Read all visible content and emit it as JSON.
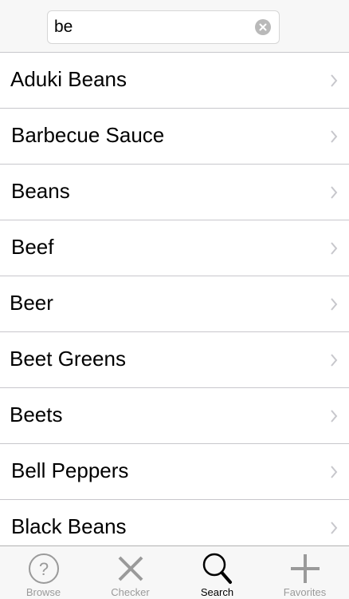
{
  "search": {
    "value": "be",
    "placeholder": ""
  },
  "results": [
    {
      "label": "Aduki Beans"
    },
    {
      "label": "Barbecue Sauce"
    },
    {
      "label": "Beans"
    },
    {
      "label": "Beef"
    },
    {
      "label": "Beer"
    },
    {
      "label": "Beet Greens"
    },
    {
      "label": "Beets"
    },
    {
      "label": "Bell Peppers"
    },
    {
      "label": "Black Beans"
    }
  ],
  "tabs": [
    {
      "label": "Browse",
      "icon": "question-circle-icon",
      "active": false
    },
    {
      "label": "Checker",
      "icon": "x-icon",
      "active": false
    },
    {
      "label": "Search",
      "icon": "magnifier-icon",
      "active": true
    },
    {
      "label": "Favorites",
      "icon": "plus-icon",
      "active": false
    }
  ],
  "colors": {
    "active_tab": "#000000",
    "inactive_tab": "#9a9a9a",
    "separator": "#c8c7cc",
    "chevron": "#c7c7cc"
  }
}
